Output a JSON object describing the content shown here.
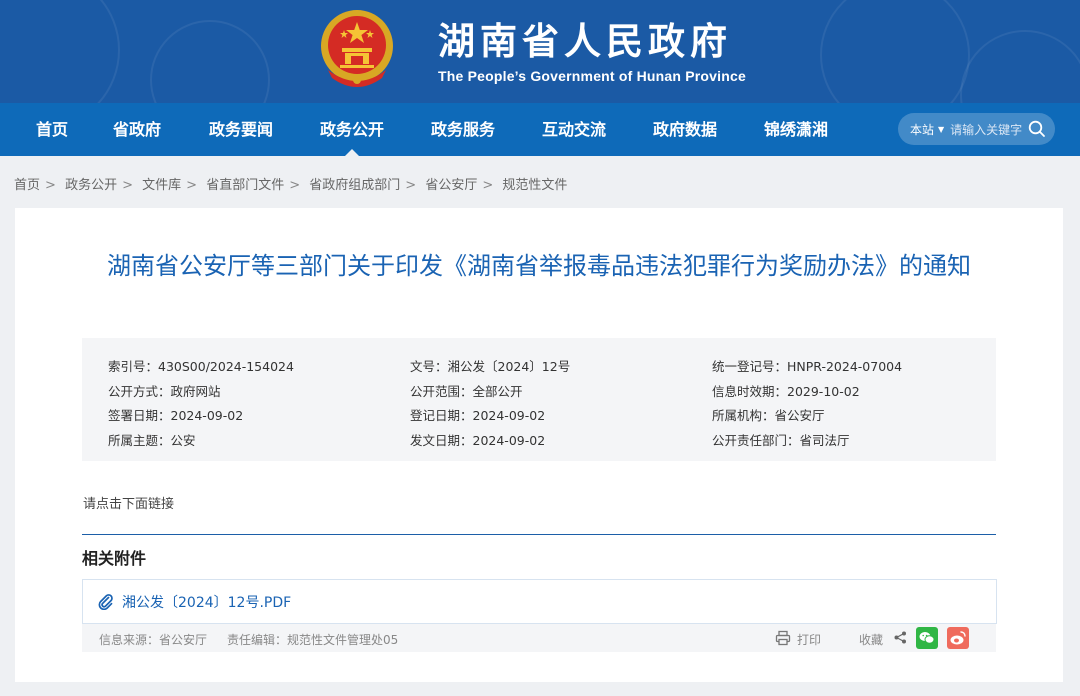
{
  "header": {
    "title_cn": "湖南省人民政府",
    "title_en": "The People’s Government of Hunan Province"
  },
  "nav": {
    "items": [
      "首页",
      "省政府",
      "政务要闻",
      "政务公开",
      "政务服务",
      "互动交流",
      "政府数据",
      "锦绣潇湘"
    ],
    "active_index": 3
  },
  "search": {
    "scope": "本站",
    "placeholder": "请输入关键字"
  },
  "breadcrumb": [
    "首页",
    "政务公开",
    "文件库",
    "省直部门文件",
    "省政府组成部门",
    "省公安厅",
    "规范性文件"
  ],
  "article": {
    "title": "湖南省公安厅等三部门关于印发《湖南省举报毒品违法犯罪行为奖励办法》的通知",
    "meta": [
      [
        "索引号：430S00/2024-154024",
        "文号：湘公发〔2024〕12号",
        "统一登记号：HNPR-2024-07004"
      ],
      [
        "公开方式：政府网站",
        "公开范围：全部公开",
        "信息时效期：2029-10-02"
      ],
      [
        "签署日期：2024-09-02",
        "登记日期：2024-09-02",
        "所属机构：省公安厅"
      ],
      [
        "所属主题：公安",
        "发文日期：2024-09-02",
        "公开责任部门：省司法厅"
      ]
    ],
    "intro": "请点击下面链接"
  },
  "attachments": {
    "heading": "相关附件",
    "file": "湘公发〔2024〕12号.PDF"
  },
  "footer": {
    "source": "信息来源：省公安厅",
    "editor": "责任编辑：规范性文件管理处05",
    "print": "打印",
    "favorite": "收藏"
  },
  "colors": {
    "header": "#1b5aa5",
    "nav": "#0e6ab9",
    "title": "#1a63b3",
    "wechat": "#30b645",
    "weibo": "#ef6b5d"
  }
}
